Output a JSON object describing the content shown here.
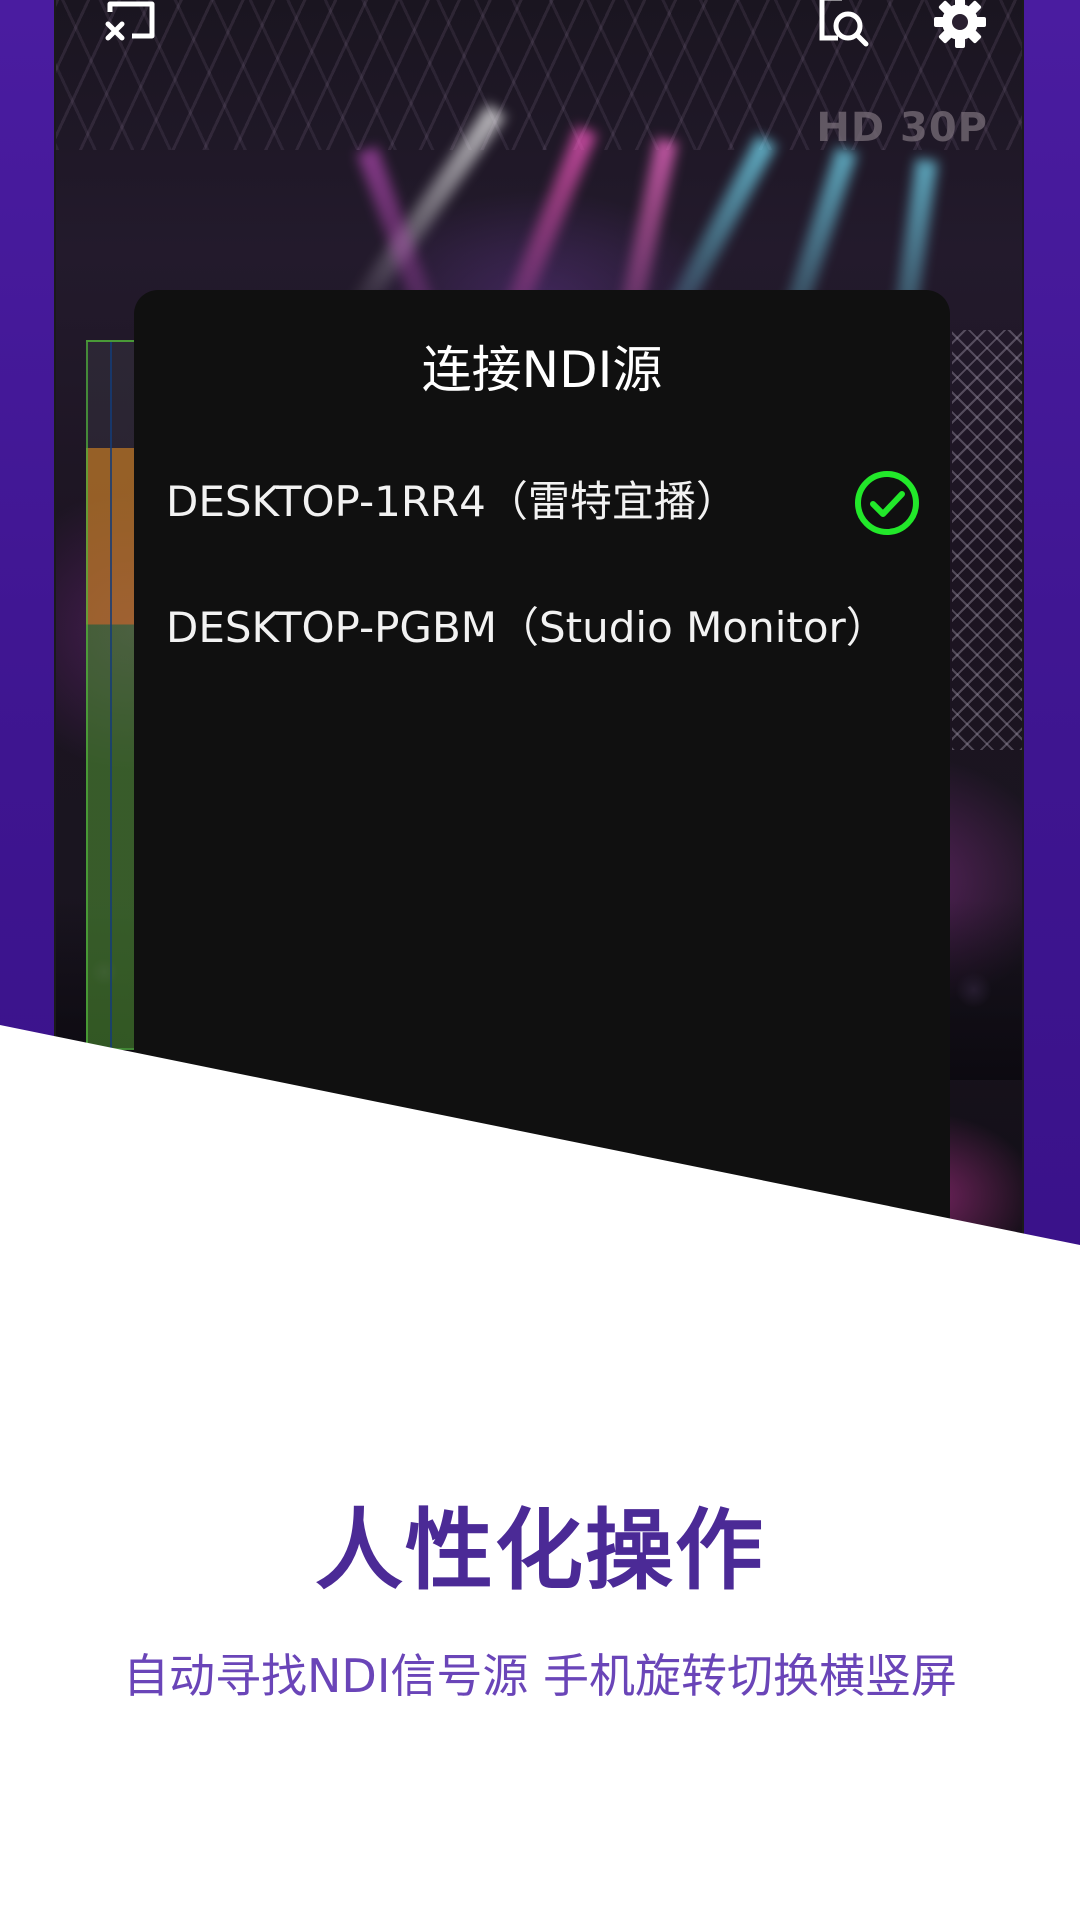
{
  "top_bar": {
    "cast_icon": "cast-exit-icon",
    "search_icon": "screen-search-icon",
    "settings_icon": "gear-icon"
  },
  "video": {
    "quality_label": "HD 30P"
  },
  "dialog": {
    "title": "连接NDI源",
    "sources": [
      {
        "label": "DESKTOP-1RR4（雷特宜播）",
        "selected": true
      },
      {
        "label": "DESKTOP-PGBM（Studio Monitor）",
        "selected": false
      }
    ]
  },
  "promo": {
    "headline": "人性化操作",
    "subline": "自动寻找NDI信号源 手机旋转切换横竖屏"
  },
  "colors": {
    "accent_purple": "#4b2a96",
    "check_green": "#22e82a",
    "backdrop_purple": "#4a1ca0"
  }
}
